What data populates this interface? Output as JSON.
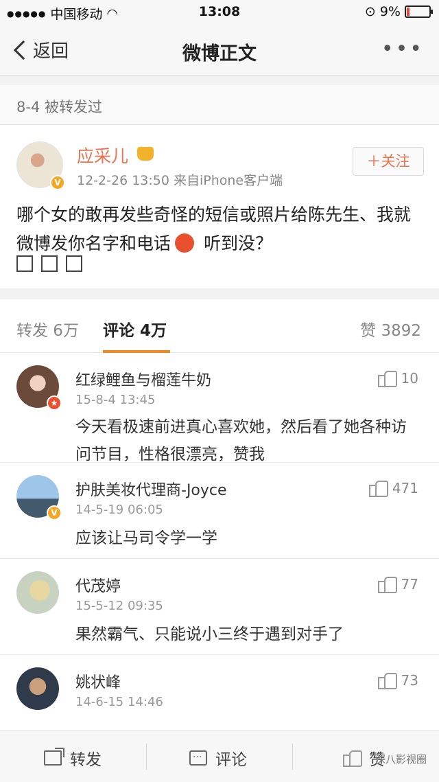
{
  "status_bar": {
    "signal": "●●●●●",
    "carrier": "中国移动",
    "wifi": "wifi-icon",
    "time": "13:08",
    "battery_percent": "9%"
  },
  "nav": {
    "back_label": "返回",
    "title": "微博正文",
    "more": "•••"
  },
  "repost_note": "8-4 被转发过",
  "post": {
    "author": "应采儿",
    "meta": "12-2-26 13:50 来自iPhone客户端",
    "follow_label": "＋关注",
    "text_part1": "哪个女的敢再发些奇怪的短信或照片给陈先生、我就微博发你名字和电话",
    "text_part2": " 听到没？",
    "verified_badge": "V"
  },
  "tabs": {
    "forward": "转发 6万",
    "comment": "评论 4万",
    "like": "赞 3892"
  },
  "comments": [
    {
      "name": "红绿鲤鱼与榴莲牛奶",
      "time": "15-8-4 13:45",
      "text": "今天看极速前进真心喜欢她，然后看了她各种访问节目，性格很漂亮，赞我",
      "likes": "10"
    },
    {
      "name": "护肤美妆代理商-Joyce",
      "time": "14-5-19 06:05",
      "text": "应该让马司令学一学",
      "likes": "471"
    },
    {
      "name": "代茂婷",
      "time": "15-5-12 09:35",
      "text": "果然霸气、只能说小三终于遇到对手了",
      "likes": "77"
    },
    {
      "name": "姚状峰",
      "time": "14-6-15 14:46",
      "text": "",
      "likes": "73"
    }
  ],
  "bottom_bar": {
    "forward": "转发",
    "comment": "评论",
    "like": "赞",
    "watermark": "深八影视圈"
  },
  "colors": {
    "accent_orange": "#eb7350",
    "tab_underline": "#f08a24",
    "battery_low": "#ee4433"
  }
}
